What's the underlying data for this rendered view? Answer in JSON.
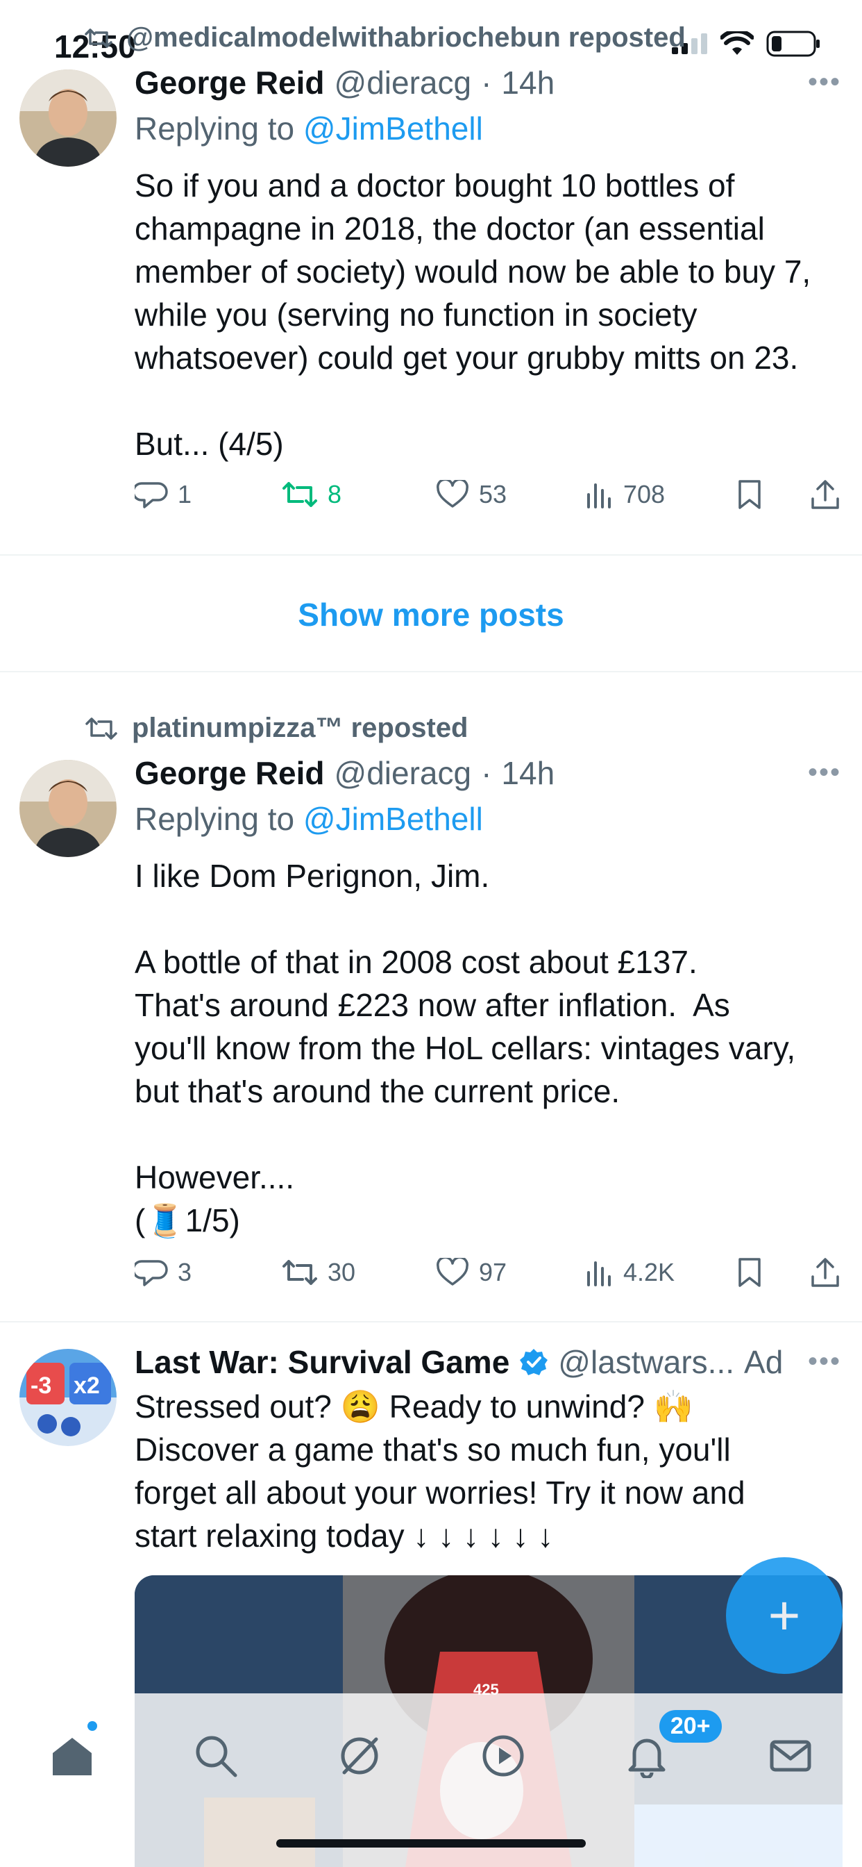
{
  "status": {
    "time": "12:50"
  },
  "tweet1": {
    "repost_by": "@medicalmodelwithabriochebun reposted",
    "name": "George Reid",
    "handle": "@dieracg",
    "sep": "·",
    "time": "14h",
    "replying_prefix": "Replying to",
    "replying_to": "@JimBethell",
    "text": "So if you and a doctor bought 10 bottles of\nchampagne in 2018, the doctor (an essential\nmember of society) would now be able to buy 7,\nwhile you (serving no function in society\nwhatsoever) could get your grubby mitts on 23.\n\nBut... (4/5)",
    "replies": "1",
    "reposts": "8",
    "likes": "53",
    "views": "708"
  },
  "show_more_label": "Show more posts",
  "tweet2": {
    "repost_by": "platinumpizza™ reposted",
    "name": "George Reid",
    "handle": "@dieracg",
    "sep": "·",
    "time": "14h",
    "replying_prefix": "Replying to",
    "replying_to": "@JimBethell",
    "text": "I like Dom Perignon, Jim.\n\nA bottle of that in 2008 cost about £137.\nThat's around £223 now after inflation.  As\nyou'll know from the HoL cellars: vintages vary,\nbut that's around the current price.\n\nHowever....\n(🧵1/5)",
    "replies": "3",
    "reposts": "30",
    "likes": "97",
    "views": "4.2K"
  },
  "ad": {
    "name": "Last War: Survival Game",
    "handle": "@lastwars...",
    "ad_label": "Ad",
    "text": "Stressed out? 😩 Ready to unwind? 🙌\nDiscover a game that's so much fun, you'll\nforget all about your worries! Try it now and\nstart relaxing today ↓ ↓ ↓ ↓ ↓ ↓",
    "avatar_text_left": "-3",
    "avatar_text_right": "x2",
    "media_counter": "425"
  },
  "fab_label": "+",
  "tabbar": {
    "notifications_badge": "20+"
  },
  "colors": {
    "accent": "#1d9bf0",
    "repost_green": "#00ba7c",
    "muted": "#536471"
  }
}
